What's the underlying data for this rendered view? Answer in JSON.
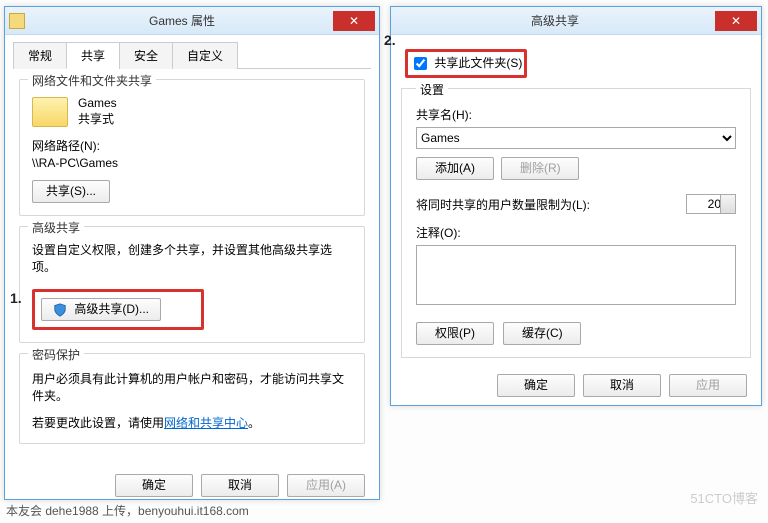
{
  "annot": {
    "one": "1.",
    "two": "2."
  },
  "win1": {
    "title": "Games 属性",
    "tabs": [
      "常规",
      "共享",
      "安全",
      "自定义"
    ],
    "activeTab": 1,
    "group1": {
      "title": "网络文件和文件夹共享",
      "folder_name": "Games",
      "folder_status": "共享式",
      "path_label": "网络路径(N):",
      "path_value": "\\\\RA-PC\\Games",
      "share_btn": "共享(S)..."
    },
    "group2": {
      "title": "高级共享",
      "desc": "设置自定义权限，创建多个共享，并设置其他高级共享选项。",
      "adv_btn": "高级共享(D)..."
    },
    "group3": {
      "title": "密码保护",
      "line1": "用户必须具有此计算机的用户帐户和密码，才能访问共享文件夹。",
      "line2_a": "若要更改此设置，请使用",
      "line2_link": "网络和共享中心",
      "line2_b": "。"
    },
    "buttons": {
      "ok": "确定",
      "cancel": "取消",
      "apply": "应用(A)"
    }
  },
  "win2": {
    "title": "高级共享",
    "share_cbx": "共享此文件夹(S)",
    "share_checked": true,
    "settings_title": "设置",
    "sharename_label": "共享名(H):",
    "sharename_value": "Games",
    "add_btn": "添加(A)",
    "del_btn": "删除(R)",
    "limit_label": "将同时共享的用户数量限制为(L):",
    "limit_value": "20",
    "comment_label": "注释(O):",
    "perm_btn": "权限(P)",
    "cache_btn": "缓存(C)",
    "buttons": {
      "ok": "确定",
      "cancel": "取消",
      "apply": "应用"
    }
  },
  "footer": "本友会 dehe1988 上传，benyouhui.it168.com",
  "watermark": "51CTO博客"
}
